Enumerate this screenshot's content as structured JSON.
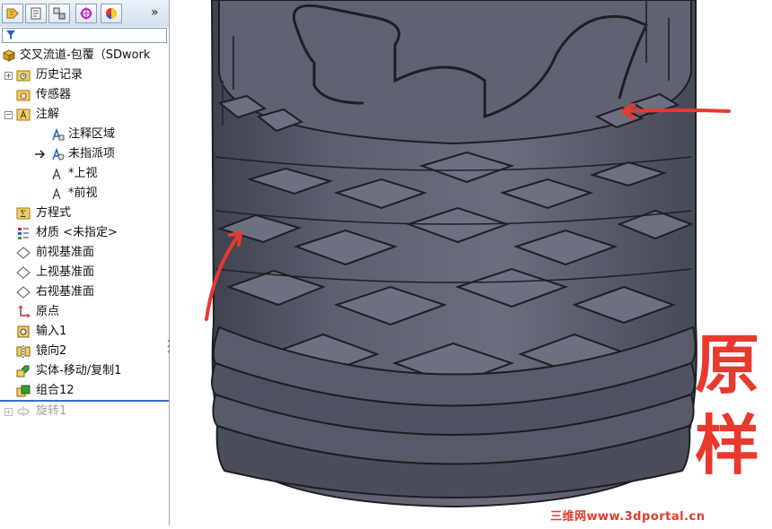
{
  "feature_tree": {
    "filter_icon": "funnel-icon",
    "part_name": "交叉流道-包覆（SDwork",
    "items": [
      {
        "label": "历史记录",
        "icon": "history-folder-icon"
      },
      {
        "label": "传感器",
        "icon": "sensor-folder-icon"
      },
      {
        "label": "注解",
        "icon": "annotations-icon"
      },
      {
        "label": "注释区域",
        "icon": "note-area-icon"
      },
      {
        "label": "未指派项",
        "icon": "unassigned-items-icon"
      },
      {
        "label": "*上视",
        "icon": "top-view-icon"
      },
      {
        "label": "*前视",
        "icon": "front-view-icon"
      },
      {
        "label": "方程式",
        "icon": "equations-icon"
      },
      {
        "label": "材质 <未指定>",
        "icon": "material-icon"
      },
      {
        "label": "前视基准面",
        "icon": "plane-icon"
      },
      {
        "label": "上视基准面",
        "icon": "plane-icon"
      },
      {
        "label": "右视基准面",
        "icon": "plane-icon"
      },
      {
        "label": "原点",
        "icon": "origin-icon"
      },
      {
        "label": "输入1",
        "icon": "import-icon"
      },
      {
        "label": "镜向2",
        "icon": "mirror-icon"
      },
      {
        "label": "实体-移动/复制1",
        "icon": "move-copy-icon"
      },
      {
        "label": "组合12",
        "icon": "combine-icon"
      },
      {
        "label": "旋转1",
        "icon": "revolve-icon",
        "suppressed": true
      }
    ]
  },
  "viewport": {
    "annotation_text_1": "原",
    "annotation_text_2": "样",
    "watermark": "三维网www.3dportal.cn",
    "annotation_color": "#e8392f",
    "model_color": "#5c5f6e"
  }
}
